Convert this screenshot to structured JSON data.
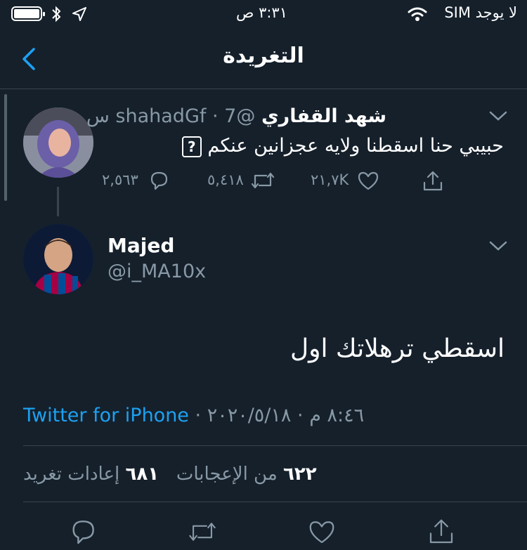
{
  "status_bar": {
    "carrier": "لا يوجد SIM",
    "time": "٣:٣١ ص"
  },
  "header": {
    "title": "التغريدة"
  },
  "reply_tweet": {
    "name": "شهد القفاري",
    "handle": "@shahadGf",
    "time": "7 س",
    "separator": "·",
    "text": "حبيبي حنا اسقطنا ولايه عجزانين عنكم",
    "emoji_label": "?",
    "replies": "٢,٥٦٣",
    "retweets": "٥,٤١٨",
    "likes": "٢١,٧K"
  },
  "main_tweet": {
    "name": "Majed",
    "handle": "@i_MA10x",
    "text": "اسقطي ترهلاتك اول",
    "source": "Twitter for iPhone",
    "meta_time": "٨:٤٦ م",
    "meta_date": "٢٠٢٠/٥/١٨",
    "separator": "·",
    "likes_count": "٦٢٢",
    "likes_label": "من الإعجابات",
    "retweets_count": "٦٨١",
    "retweets_label": "إعادات تغريد"
  },
  "colors": {
    "background": "#15202b",
    "muted": "#8899a6",
    "accent": "#1da1f2",
    "divider": "#38444d"
  },
  "icons": [
    "battery-icon",
    "bluetooth-icon",
    "location-arrow-icon",
    "wifi-icon",
    "back-chevron-icon",
    "chevron-down-icon",
    "reply-icon",
    "retweet-icon",
    "like-icon",
    "share-icon"
  ]
}
